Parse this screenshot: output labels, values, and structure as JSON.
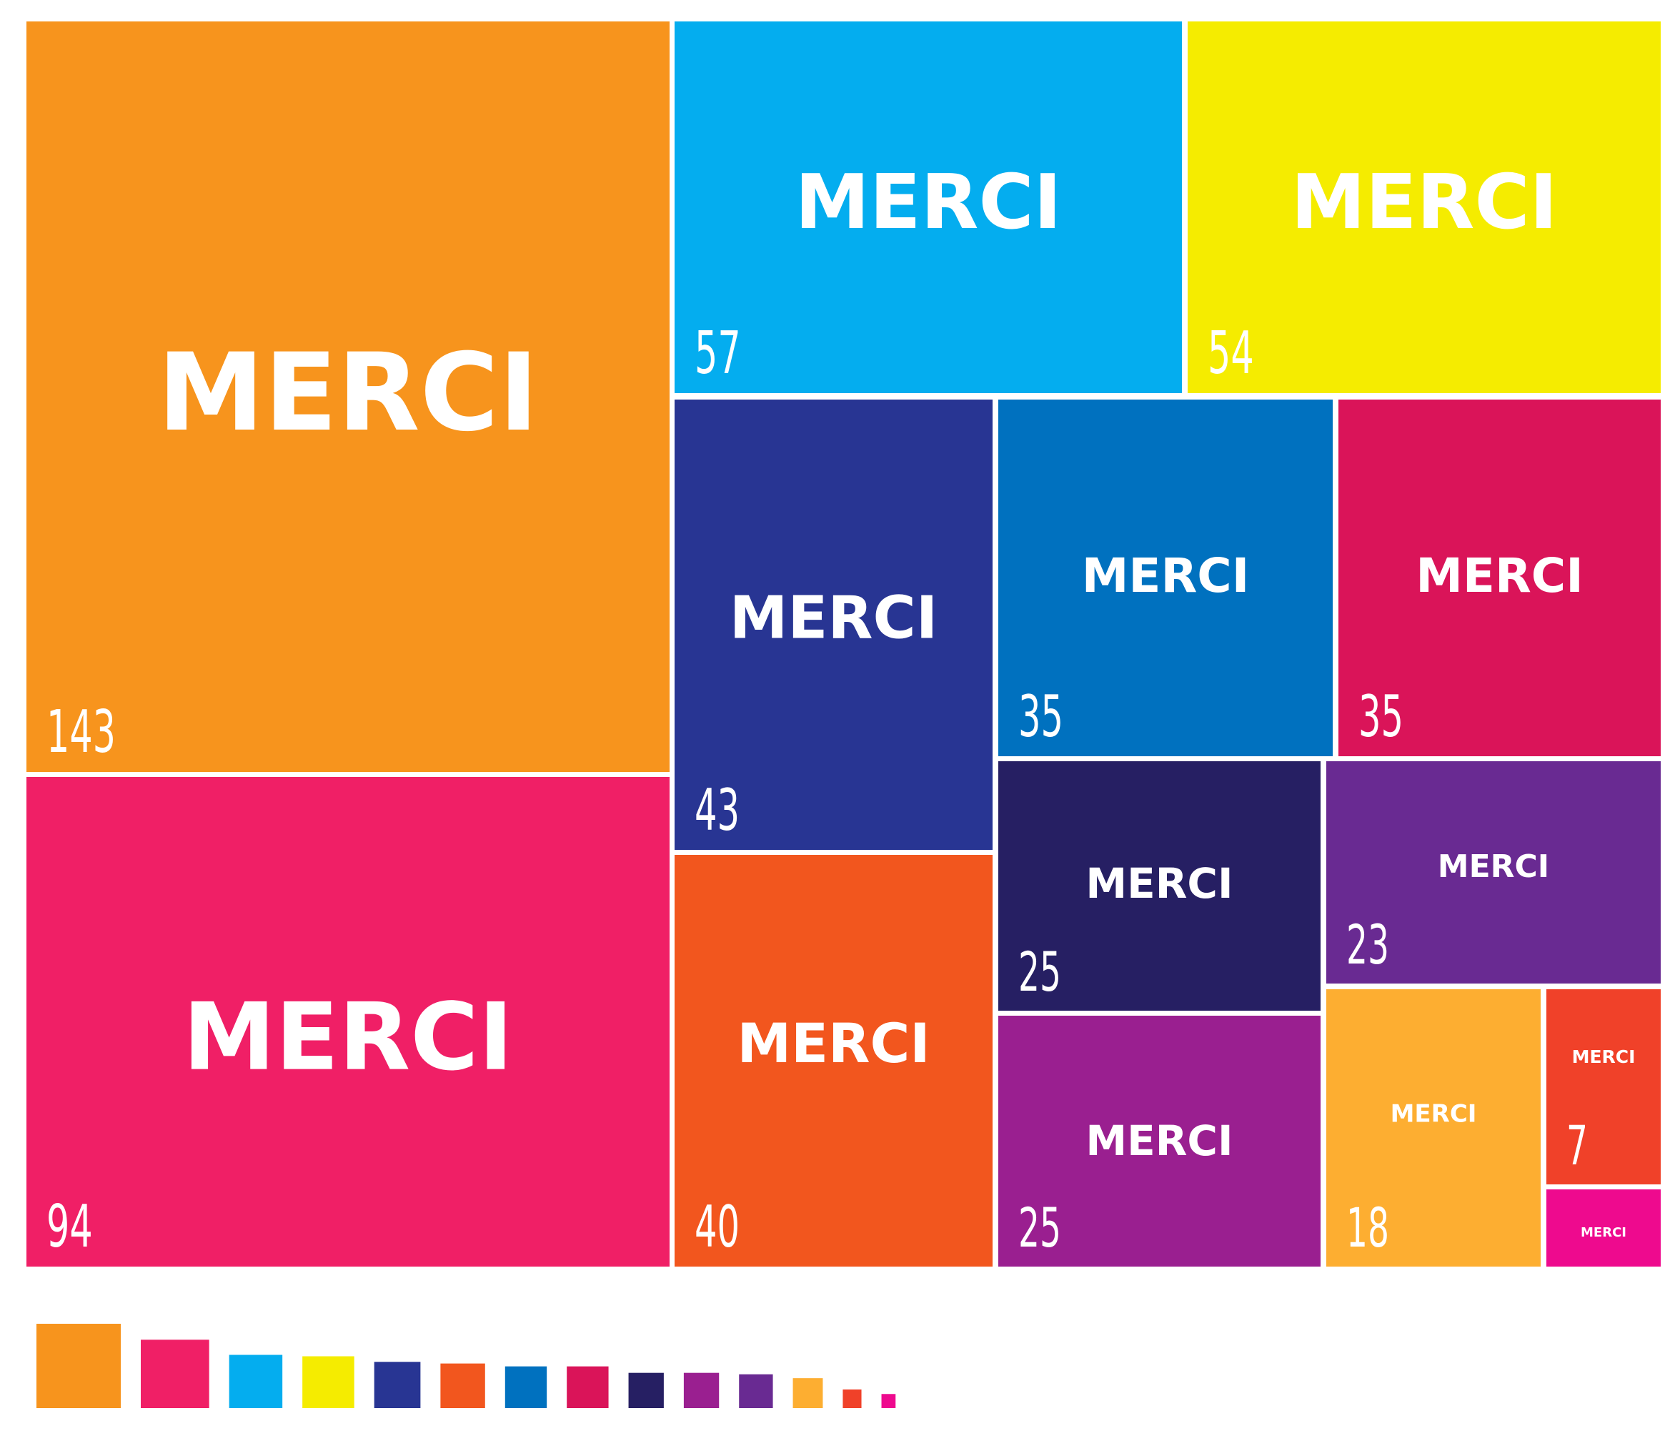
{
  "chart_data": {
    "type": "treemap",
    "items": [
      {
        "label": "MERCI",
        "value": 143,
        "value_label": "143",
        "color": "#F7941D"
      },
      {
        "label": "MERCI",
        "value": 94,
        "value_label": "94",
        "color": "#F01F66"
      },
      {
        "label": "MERCI",
        "value": 57,
        "value_label": "57",
        "color": "#04ADEF"
      },
      {
        "label": "MERCI",
        "value": 54,
        "value_label": "54",
        "color": "#F5EC00"
      },
      {
        "label": "MERCI",
        "value": 43,
        "value_label": "43",
        "color": "#283593"
      },
      {
        "label": "MERCI",
        "value": 40,
        "value_label": "40",
        "color": "#F2561E"
      },
      {
        "label": "MERCI",
        "value": 35,
        "value_label": "35",
        "color": "#0071BF"
      },
      {
        "label": "MERCI",
        "value": 35,
        "value_label": "35",
        "color": "#DA1459"
      },
      {
        "label": "MERCI",
        "value": 25,
        "value_label": "25",
        "color": "#261F63"
      },
      {
        "label": "MERCI",
        "value": 25,
        "value_label": "25",
        "color": "#9A1F90"
      },
      {
        "label": "MERCI",
        "value": 23,
        "value_label": "23",
        "color": "#692A92"
      },
      {
        "label": "MERCI",
        "value": 18,
        "value_label": "18",
        "color": "#FDAE31"
      },
      {
        "label": "MERCI",
        "value": 7,
        "value_label": "7",
        "color": "#F04129"
      },
      {
        "label": "MERCI",
        "value": 4,
        "value_label": "",
        "color": "#EE0A8E"
      }
    ]
  }
}
